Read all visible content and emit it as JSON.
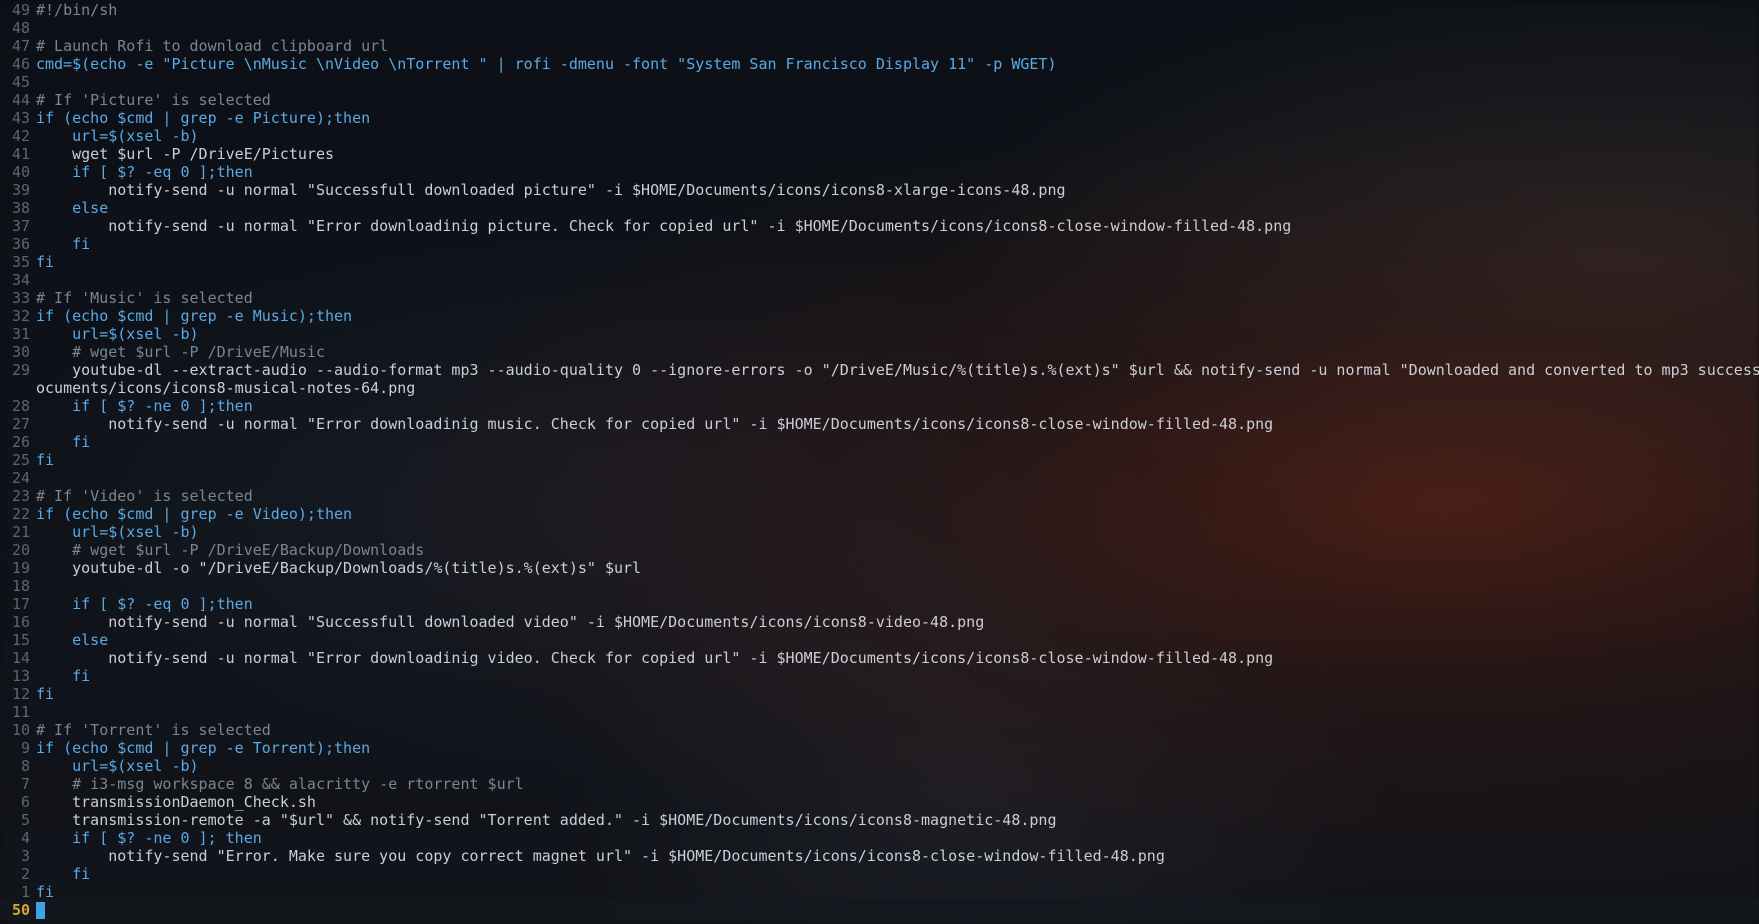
{
  "colors": {
    "line_number": "#5d6670",
    "current_line_number": "#d8a531",
    "comment": "#7b8591",
    "keyword": "#5aa9e6",
    "string": "#2e8fd6",
    "flag": "#3cbf5a",
    "variable": "#2f7fd6",
    "text": "#c9cfd6",
    "cursor": "#3ea3e6"
  },
  "editor": {
    "lines": [
      {
        "n": "49",
        "t": "#!/bin/sh",
        "c": "comment"
      },
      {
        "n": "48",
        "t": "",
        "c": "text"
      },
      {
        "n": "47",
        "t": "# Launch Rofi to download clipboard url",
        "c": "comment"
      },
      {
        "n": "46",
        "t": "cmd=$(echo -e \"Picture \\nMusic \\nVideo \\nTorrent \" | rofi -dmenu -font \"System San Francisco Display 11\" -p WGET)",
        "c": "keyword"
      },
      {
        "n": "45",
        "t": "",
        "c": "text"
      },
      {
        "n": "44",
        "t": "# If 'Picture' is selected",
        "c": "comment"
      },
      {
        "n": "43",
        "t": "if (echo $cmd | grep -e Picture);then",
        "c": "keyword"
      },
      {
        "n": "42",
        "t": "    url=$(xsel -b)",
        "c": "keyword"
      },
      {
        "n": "41",
        "t": "    wget $url -P /DriveE/Pictures",
        "c": "text"
      },
      {
        "n": "40",
        "t": "    if [ $? -eq 0 ];then",
        "c": "keyword"
      },
      {
        "n": "39",
        "t": "        notify-send -u normal \"Successfull downloaded picture\" -i $HOME/Documents/icons/icons8-xlarge-icons-48.png",
        "c": "text"
      },
      {
        "n": "38",
        "t": "    else",
        "c": "keyword"
      },
      {
        "n": "37",
        "t": "        notify-send -u normal \"Error downloadinig picture. Check for copied url\" -i $HOME/Documents/icons/icons8-close-window-filled-48.png",
        "c": "text"
      },
      {
        "n": "36",
        "t": "    fi",
        "c": "keyword"
      },
      {
        "n": "35",
        "t": "fi",
        "c": "keyword"
      },
      {
        "n": "34",
        "t": "",
        "c": "text"
      },
      {
        "n": "33",
        "t": "# If 'Music' is selected",
        "c": "comment"
      },
      {
        "n": "32",
        "t": "if (echo $cmd | grep -e Music);then",
        "c": "keyword"
      },
      {
        "n": "31",
        "t": "    url=$(xsel -b)",
        "c": "keyword"
      },
      {
        "n": "30",
        "t": "    # wget $url -P /DriveE/Music",
        "c": "comment"
      },
      {
        "n": "29",
        "t": "    youtube-dl --extract-audio --audio-format mp3 --audio-quality 0 --ignore-errors -o \"/DriveE/Music/%(title)s.%(ext)s\" $url && notify-send -u normal \"Downloaded and converted to mp3 success",
        "c": "text"
      },
      {
        "n": "",
        "t": "ocuments/icons/icons8-musical-notes-64.png",
        "c": "text"
      },
      {
        "n": "28",
        "t": "    if [ $? -ne 0 ];then",
        "c": "keyword"
      },
      {
        "n": "27",
        "t": "        notify-send -u normal \"Error downloadinig music. Check for copied url\" -i $HOME/Documents/icons/icons8-close-window-filled-48.png",
        "c": "text"
      },
      {
        "n": "26",
        "t": "    fi",
        "c": "keyword"
      },
      {
        "n": "25",
        "t": "fi",
        "c": "keyword"
      },
      {
        "n": "24",
        "t": "",
        "c": "text"
      },
      {
        "n": "23",
        "t": "# If 'Video' is selected",
        "c": "comment"
      },
      {
        "n": "22",
        "t": "if (echo $cmd | grep -e Video);then",
        "c": "keyword"
      },
      {
        "n": "21",
        "t": "    url=$(xsel -b)",
        "c": "keyword"
      },
      {
        "n": "20",
        "t": "    # wget $url -P /DriveE/Backup/Downloads",
        "c": "comment"
      },
      {
        "n": "19",
        "t": "    youtube-dl -o \"/DriveE/Backup/Downloads/%(title)s.%(ext)s\" $url",
        "c": "text"
      },
      {
        "n": "18",
        "t": "",
        "c": "text"
      },
      {
        "n": "17",
        "t": "    if [ $? -eq 0 ];then",
        "c": "keyword"
      },
      {
        "n": "16",
        "t": "        notify-send -u normal \"Successfull downloaded video\" -i $HOME/Documents/icons/icons8-video-48.png",
        "c": "text"
      },
      {
        "n": "15",
        "t": "    else",
        "c": "keyword"
      },
      {
        "n": "14",
        "t": "        notify-send -u normal \"Error downloadinig video. Check for copied url\" -i $HOME/Documents/icons/icons8-close-window-filled-48.png",
        "c": "text"
      },
      {
        "n": "13",
        "t": "    fi",
        "c": "keyword"
      },
      {
        "n": "12",
        "t": "fi",
        "c": "keyword"
      },
      {
        "n": "11",
        "t": "",
        "c": "text"
      },
      {
        "n": "10",
        "t": "# If 'Torrent' is selected",
        "c": "comment"
      },
      {
        "n": "9",
        "t": "if (echo $cmd | grep -e Torrent);then",
        "c": "keyword"
      },
      {
        "n": "8",
        "t": "    url=$(xsel -b)",
        "c": "keyword"
      },
      {
        "n": "7",
        "t": "    # i3-msg workspace 8 && alacritty -e rtorrent $url",
        "c": "comment"
      },
      {
        "n": "6",
        "t": "    transmissionDaemon_Check.sh",
        "c": "text"
      },
      {
        "n": "5",
        "t": "    transmission-remote -a \"$url\" && notify-send \"Torrent added.\" -i $HOME/Documents/icons/icons8-magnetic-48.png",
        "c": "text"
      },
      {
        "n": "4",
        "t": "    if [ $? -ne 0 ]; then",
        "c": "keyword"
      },
      {
        "n": "3",
        "t": "        notify-send \"Error. Make sure you copy correct magnet url\" -i $HOME/Documents/icons/icons8-close-window-filled-48.png",
        "c": "text"
      },
      {
        "n": "2",
        "t": "    fi",
        "c": "keyword"
      },
      {
        "n": "1",
        "t": "fi",
        "c": "keyword"
      }
    ],
    "current_line_number": "50"
  }
}
